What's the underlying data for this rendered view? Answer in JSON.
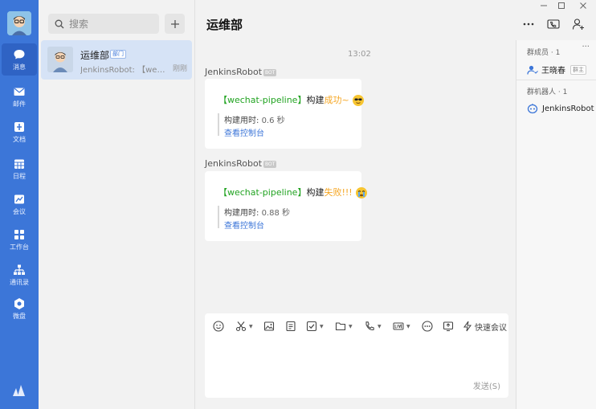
{
  "nav": {
    "items": [
      {
        "label": "消息",
        "icon": "message-icon"
      },
      {
        "label": "邮件",
        "icon": "mail-icon"
      },
      {
        "label": "文档",
        "icon": "document-icon"
      },
      {
        "label": "日程",
        "icon": "calendar-icon"
      },
      {
        "label": "会议",
        "icon": "meeting-icon"
      },
      {
        "label": "工作台",
        "icon": "workbench-icon"
      },
      {
        "label": "通讯录",
        "icon": "contacts-icon"
      },
      {
        "label": "微盘",
        "icon": "drive-icon"
      }
    ]
  },
  "search": {
    "placeholder": "搜索"
  },
  "conversation": {
    "name": "运维部",
    "badge": "部门",
    "preview": "JenkinsRobot: 【wec...",
    "time": "刚刚"
  },
  "chat": {
    "title": "运维部",
    "time_divider": "13:02",
    "bot_tag": "BOT",
    "messages": [
      {
        "sender": "JenkinsRobot",
        "bracket_text": "【wechat-pipeline】",
        "action": "构建",
        "status": "成功~",
        "duration_label": "构建用时: ",
        "duration": "0.6 秒",
        "link": "查看控制台"
      },
      {
        "sender": "JenkinsRobot",
        "bracket_text": "【wechat-pipeline】",
        "action": "构建",
        "status": "失败!!!",
        "duration_label": "构建用时: ",
        "duration": "0.88 秒",
        "link": "查看控制台"
      }
    ]
  },
  "composer": {
    "quick_meeting": "快速会议",
    "send": "发送(S)"
  },
  "side_panel": {
    "members_header": "群成员 · 1",
    "member_name": "王晓春",
    "owner_tag": "群主",
    "robots_header": "群机器人 · 1",
    "robot_name": "JenkinsRobot",
    "more": "···"
  },
  "colors": {
    "rail": "#3c76d8",
    "link": "#3c76d8",
    "success_green": "#21a321",
    "status_orange": "#f5a623"
  }
}
